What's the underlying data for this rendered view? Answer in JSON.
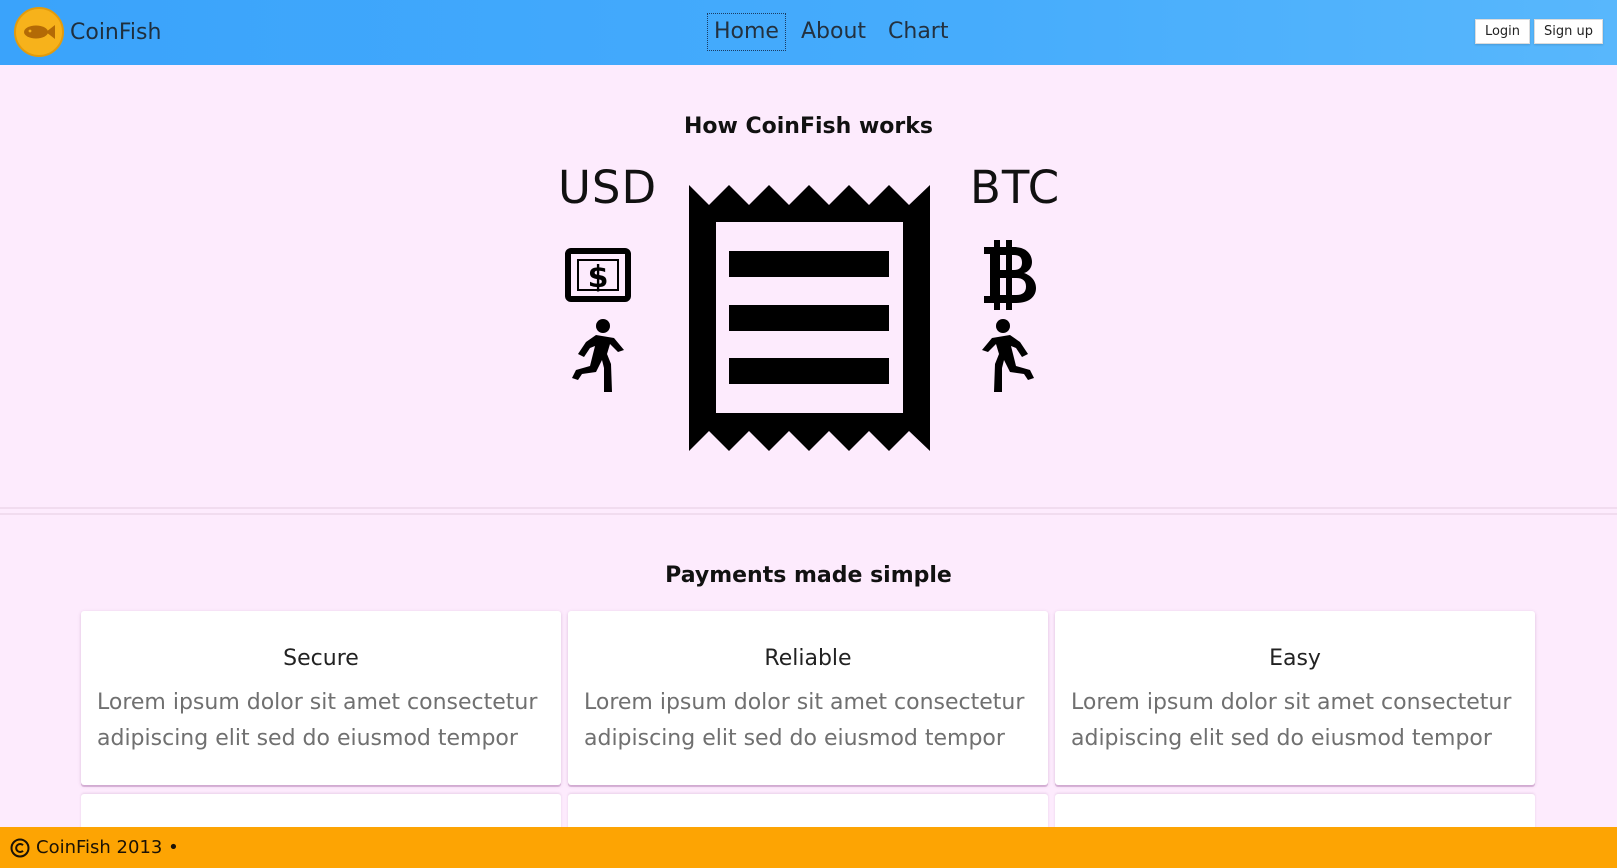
{
  "brand": {
    "name": "CoinFish",
    "logo_color": "#f7b21b",
    "fish_color": "#b36a06"
  },
  "nav": {
    "links": [
      {
        "label": "Home",
        "active": true
      },
      {
        "label": "About",
        "active": false
      },
      {
        "label": "Chart",
        "active": false
      }
    ]
  },
  "auth": {
    "login_label": "Login",
    "signup_label": "Sign up"
  },
  "hero": {
    "title": "How CoinFish works",
    "left_currency": "USD",
    "right_currency": "BTC",
    "icons": [
      "dollar-bill-icon",
      "runner-icon",
      "receipt-icon",
      "bitcoin-icon",
      "runner-icon"
    ]
  },
  "features": {
    "title": "Payments made simple",
    "cards": [
      {
        "title": "Secure",
        "body": "Lorem ipsum dolor sit amet consectetur adipiscing elit sed do eiusmod tempor"
      },
      {
        "title": "Reliable",
        "body": "Lorem ipsum dolor sit amet consectetur adipiscing elit sed do eiusmod tempor"
      },
      {
        "title": "Easy",
        "body": "Lorem ipsum dolor sit amet consectetur adipiscing elit sed do eiusmod tempor"
      }
    ]
  },
  "footer": {
    "text": "CoinFish 2013 •",
    "background": "#fda403"
  },
  "colors": {
    "nav_gradient_start": "#3aa3fb",
    "page_background": "#fdebfd"
  }
}
